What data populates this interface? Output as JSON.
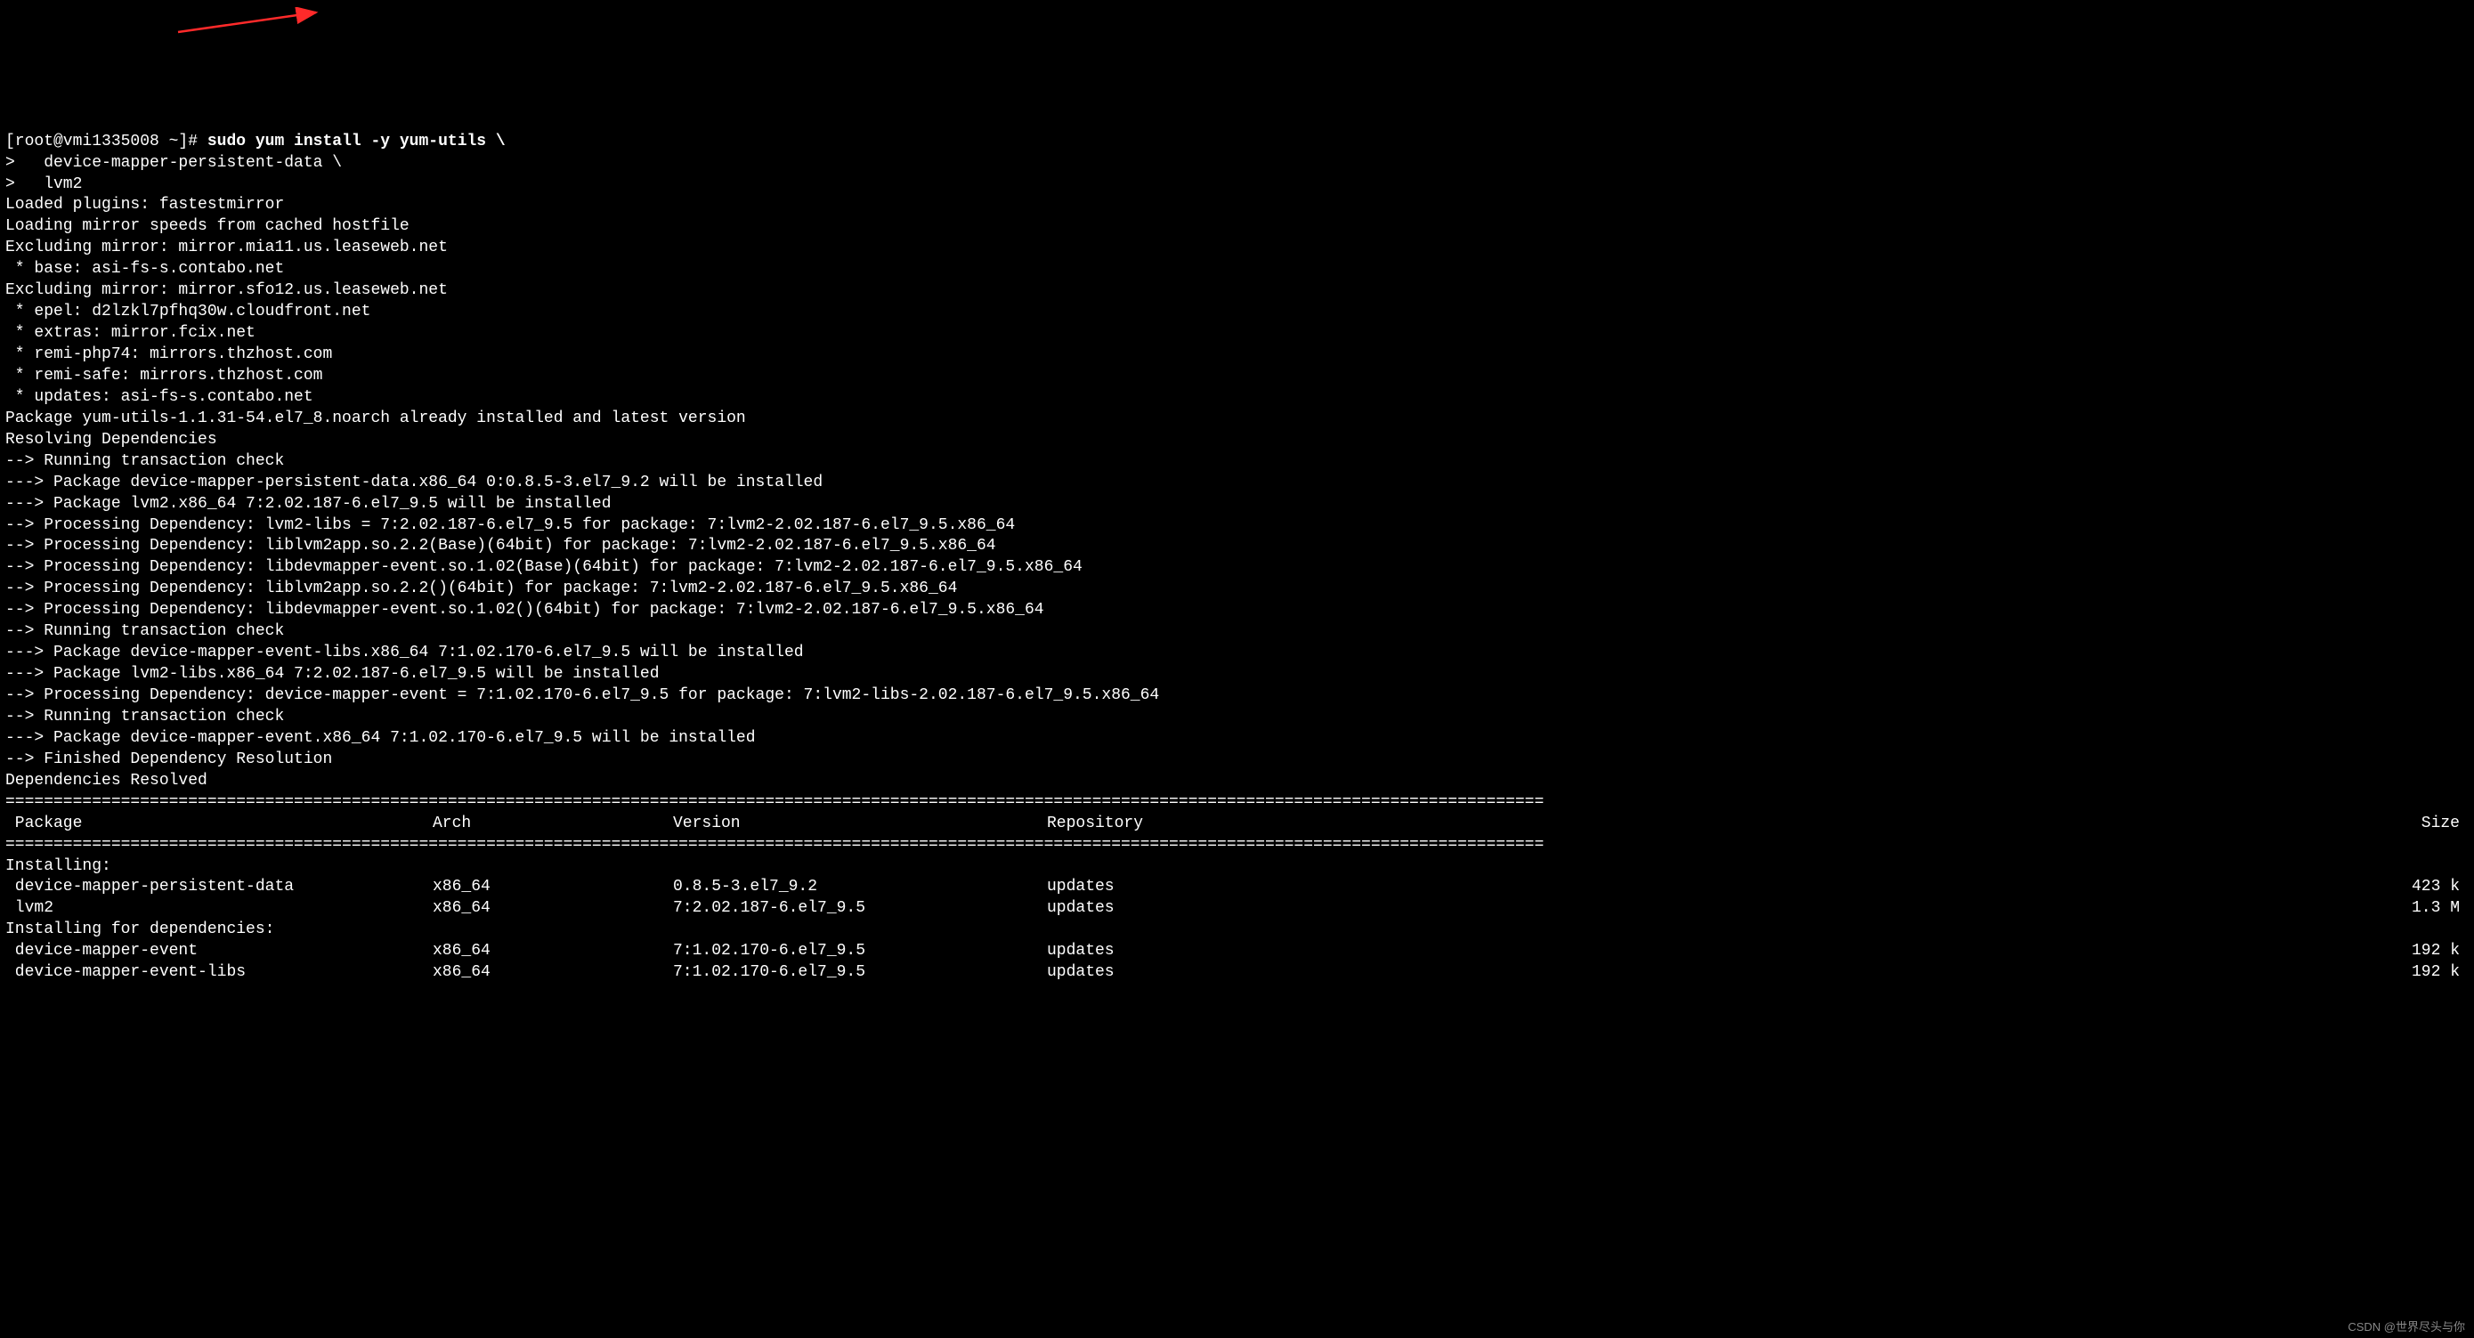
{
  "prompt": {
    "line1_prefix": "[root@vmi1335008 ~]# ",
    "line1_cmd": "sudo yum install -y yum-utils \\",
    "line2": ">   device-mapper-persistent-data \\",
    "line3": ">   lvm2"
  },
  "plugin_lines": [
    "Loaded plugins: fastestmirror",
    "Loading mirror speeds from cached hostfile",
    "Excluding mirror: mirror.mia11.us.leaseweb.net",
    " * base: asi-fs-s.contabo.net",
    "Excluding mirror: mirror.sfo12.us.leaseweb.net",
    " * epel: d2lzkl7pfhq30w.cloudfront.net",
    " * extras: mirror.fcix.net",
    " * remi-php74: mirrors.thzhost.com",
    " * remi-safe: mirrors.thzhost.com",
    " * updates: asi-fs-s.contabo.net",
    "Package yum-utils-1.1.31-54.el7_8.noarch already installed and latest version",
    "Resolving Dependencies",
    "--> Running transaction check",
    "---> Package device-mapper-persistent-data.x86_64 0:0.8.5-3.el7_9.2 will be installed",
    "---> Package lvm2.x86_64 7:2.02.187-6.el7_9.5 will be installed",
    "--> Processing Dependency: lvm2-libs = 7:2.02.187-6.el7_9.5 for package: 7:lvm2-2.02.187-6.el7_9.5.x86_64",
    "--> Processing Dependency: liblvm2app.so.2.2(Base)(64bit) for package: 7:lvm2-2.02.187-6.el7_9.5.x86_64",
    "--> Processing Dependency: libdevmapper-event.so.1.02(Base)(64bit) for package: 7:lvm2-2.02.187-6.el7_9.5.x86_64",
    "--> Processing Dependency: liblvm2app.so.2.2()(64bit) for package: 7:lvm2-2.02.187-6.el7_9.5.x86_64",
    "--> Processing Dependency: libdevmapper-event.so.1.02()(64bit) for package: 7:lvm2-2.02.187-6.el7_9.5.x86_64",
    "--> Running transaction check",
    "---> Package device-mapper-event-libs.x86_64 7:1.02.170-6.el7_9.5 will be installed",
    "---> Package lvm2-libs.x86_64 7:2.02.187-6.el7_9.5 will be installed",
    "--> Processing Dependency: device-mapper-event = 7:1.02.170-6.el7_9.5 for package: 7:lvm2-libs-2.02.187-6.el7_9.5.x86_64",
    "--> Running transaction check",
    "---> Package device-mapper-event.x86_64 7:1.02.170-6.el7_9.5 will be installed",
    "--> Finished Dependency Resolution",
    "",
    "Dependencies Resolved",
    ""
  ],
  "table": {
    "headers": {
      "pkg": " Package",
      "arch": "Arch",
      "ver": "Version",
      "repo": "Repository",
      "size": "Size"
    },
    "sections": [
      {
        "title": "Installing:",
        "rows": [
          {
            "pkg": " device-mapper-persistent-data",
            "arch": "x86_64",
            "ver": "0.8.5-3.el7_9.2",
            "repo": "updates",
            "size": "423 k"
          },
          {
            "pkg": " lvm2",
            "arch": "x86_64",
            "ver": "7:2.02.187-6.el7_9.5",
            "repo": "updates",
            "size": "1.3 M"
          }
        ]
      },
      {
        "title": "Installing for dependencies:",
        "rows": [
          {
            "pkg": " device-mapper-event",
            "arch": "x86_64",
            "ver": "7:1.02.170-6.el7_9.5",
            "repo": "updates",
            "size": "192 k"
          },
          {
            "pkg": " device-mapper-event-libs",
            "arch": "x86_64",
            "ver": "7:1.02.170-6.el7_9.5",
            "repo": "updates",
            "size": "192 k"
          }
        ]
      }
    ]
  },
  "watermark": "CSDN @世界尽头与你"
}
